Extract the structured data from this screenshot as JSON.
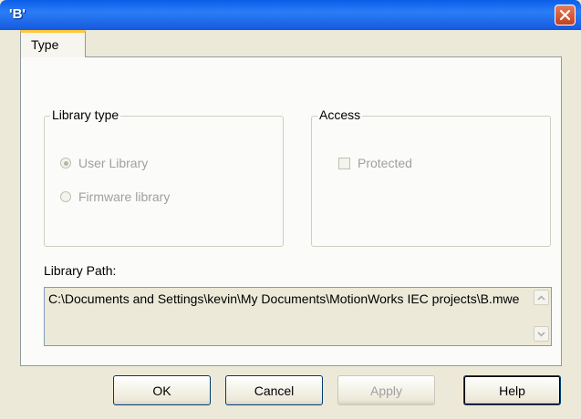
{
  "window": {
    "title": "'B'"
  },
  "tabs": [
    {
      "label": "Type"
    }
  ],
  "library_type": {
    "legend": "Library type",
    "options": [
      {
        "label": "User Library",
        "selected": true
      },
      {
        "label": "Firmware library",
        "selected": false
      }
    ]
  },
  "access": {
    "legend": "Access",
    "protected_label": "Protected",
    "protected_checked": false
  },
  "library_path": {
    "label": "Library Path:",
    "value": "C:\\Documents and Settings\\kevin\\My Documents\\MotionWorks IEC projects\\B.mwe"
  },
  "buttons": {
    "ok": "OK",
    "cancel": "Cancel",
    "apply": "Apply",
    "help": "Help"
  },
  "icons": {
    "close": "close-icon",
    "scroll_up": "arrow-up-icon",
    "scroll_down": "arrow-down-icon"
  }
}
